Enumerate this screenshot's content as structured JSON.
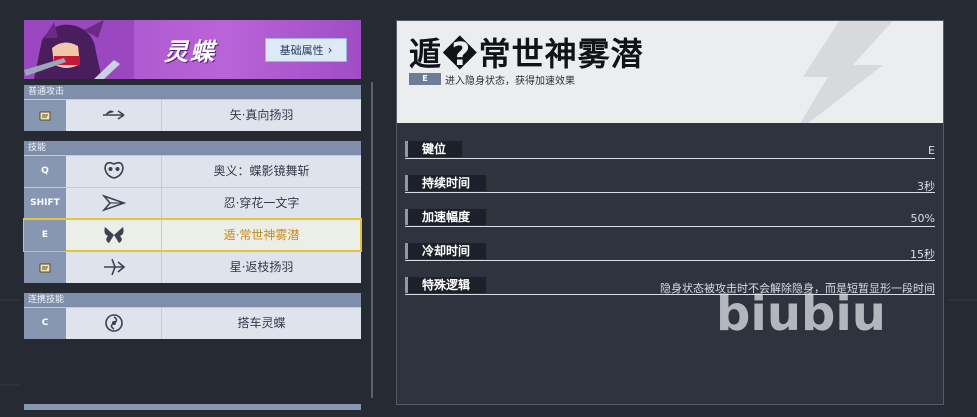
{
  "hero": {
    "name": "灵蝶",
    "attribute_button": "基础属性",
    "chevron": "›",
    "colors": {
      "banner": "#a24fc6",
      "button": "#dde9f7"
    }
  },
  "sections": [
    {
      "title": "普通攻击",
      "rows": [
        {
          "key": "",
          "key_icon": "scroll-icon",
          "icon": "feather-arrow-icon",
          "label": "矢·真向扬羽"
        }
      ]
    },
    {
      "title": "技能",
      "rows": [
        {
          "key": "Q",
          "icon": "butterfly-mask-icon",
          "label": "奥义：蝶影镜舞斩"
        },
        {
          "key": "SHIFT",
          "icon": "flower-dash-icon",
          "label": "忍·穿花一文字"
        },
        {
          "key": "E",
          "icon": "butterfly-icon",
          "label": "遁·常世神雾潜",
          "selected": true
        },
        {
          "key": "",
          "key_icon": "scroll-icon",
          "icon": "star-feather-icon",
          "label": "星·返枝扬羽"
        }
      ]
    },
    {
      "title": "连携技能",
      "rows": [
        {
          "key": "C",
          "icon": "swirl-icon",
          "label": "搭车灵蝶"
        }
      ]
    }
  ],
  "skill": {
    "title": "遁�常世神雾潜",
    "key": "E",
    "description": "进入隐身状态，获得加速效果"
  },
  "stats": [
    {
      "label": "键位",
      "value": "E"
    },
    {
      "label": "持续时间",
      "value": "3秒"
    },
    {
      "label": "加速幅度",
      "value": "50%"
    },
    {
      "label": "冷却时间",
      "value": "15秒"
    },
    {
      "label": "特殊逻辑",
      "value": "隐身状态被攻击时不会解除隐身，而是短暂显形一段时间"
    }
  ],
  "watermark": "biubiu",
  "accent": {
    "selected_border": "#e6c33c",
    "selected_text": "#c98a21"
  }
}
